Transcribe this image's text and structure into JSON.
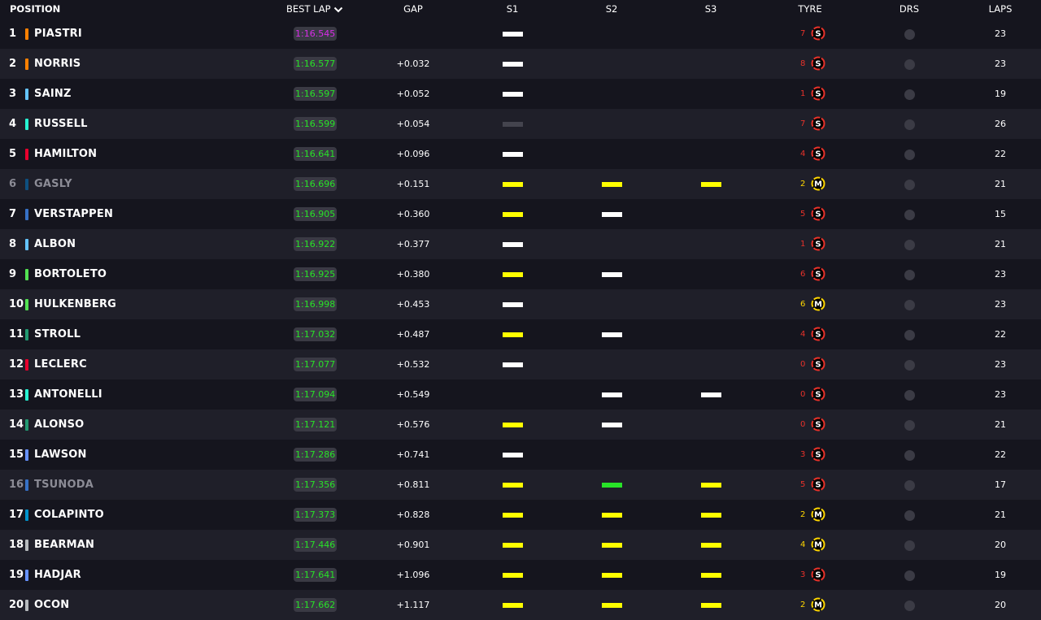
{
  "header": {
    "position": "POSITION",
    "best_lap": "BEST LAP",
    "gap": "GAP",
    "s1": "S1",
    "s2": "S2",
    "s3": "S3",
    "tyre": "TYRE",
    "drs": "DRS",
    "laps": "LAPS"
  },
  "colors": {
    "purple": "#d82ce8",
    "green": "#28e228",
    "white": "#ffffff",
    "yellow": "#ffff00",
    "soft_tyre": "#e8322a",
    "medium_tyre": "#ffd600"
  },
  "drivers": [
    {
      "pos": "1",
      "name": "PIASTRI",
      "team_color": "#ff8000",
      "best": "1:16.545",
      "best_color": "#d82ce8",
      "gap": "",
      "s1": "white",
      "s2": "",
      "s3": "",
      "tyre_age": "7",
      "tyre": "S",
      "drs": "dot",
      "laps": "23",
      "out": false
    },
    {
      "pos": "2",
      "name": "NORRIS",
      "team_color": "#ff8000",
      "best": "1:16.577",
      "best_color": "#28e228",
      "gap": "+0.032",
      "s1": "white",
      "s2": "",
      "s3": "",
      "tyre_age": "8",
      "tyre": "S",
      "drs": "dot",
      "laps": "23",
      "out": false
    },
    {
      "pos": "3",
      "name": "SAINZ",
      "team_color": "#64c4ff",
      "best": "1:16.597",
      "best_color": "#28e228",
      "gap": "+0.052",
      "s1": "white",
      "s2": "",
      "s3": "",
      "tyre_age": "1",
      "tyre": "S",
      "drs": "dot",
      "laps": "19",
      "out": false
    },
    {
      "pos": "4",
      "name": "RUSSELL",
      "team_color": "#27f4d2",
      "best": "1:16.599",
      "best_color": "#28e228",
      "gap": "+0.054",
      "s1": "grey",
      "s2": "",
      "s3": "",
      "tyre_age": "7",
      "tyre": "S",
      "drs": "dot",
      "laps": "26",
      "out": false
    },
    {
      "pos": "5",
      "name": "HAMILTON",
      "team_color": "#e8002d",
      "best": "1:16.641",
      "best_color": "#28e228",
      "gap": "+0.096",
      "s1": "white",
      "s2": "",
      "s3": "",
      "tyre_age": "4",
      "tyre": "S",
      "drs": "dot",
      "laps": "22",
      "out": false
    },
    {
      "pos": "6",
      "name": "GASLY",
      "team_color": "#0e5080",
      "best": "1:16.696",
      "best_color": "#28e228",
      "gap": "+0.151",
      "s1": "yellow",
      "s2": "yellow",
      "s3": "yellow",
      "tyre_age": "2",
      "tyre": "M",
      "drs": "dot",
      "laps": "21",
      "out": true
    },
    {
      "pos": "7",
      "name": "VERSTAPPEN",
      "team_color": "#3671c6",
      "best": "1:16.905",
      "best_color": "#28e228",
      "gap": "+0.360",
      "s1": "yellow",
      "s2": "white",
      "s3": "",
      "tyre_age": "5",
      "tyre": "S",
      "drs": "dot",
      "laps": "15",
      "out": false
    },
    {
      "pos": "8",
      "name": "ALBON",
      "team_color": "#64c4ff",
      "best": "1:16.922",
      "best_color": "#28e228",
      "gap": "+0.377",
      "s1": "white",
      "s2": "",
      "s3": "",
      "tyre_age": "1",
      "tyre": "S",
      "drs": "dot",
      "laps": "21",
      "out": false
    },
    {
      "pos": "9",
      "name": "BORTOLETO",
      "team_color": "#52e252",
      "best": "1:16.925",
      "best_color": "#28e228",
      "gap": "+0.380",
      "s1": "yellow",
      "s2": "white",
      "s3": "",
      "tyre_age": "6",
      "tyre": "S",
      "drs": "dot",
      "laps": "23",
      "out": false
    },
    {
      "pos": "10",
      "name": "HULKENBERG",
      "team_color": "#52e252",
      "best": "1:16.998",
      "best_color": "#28e228",
      "gap": "+0.453",
      "s1": "white",
      "s2": "",
      "s3": "",
      "tyre_age": "6",
      "tyre": "M",
      "drs": "dot",
      "laps": "23",
      "out": false
    },
    {
      "pos": "11",
      "name": "STROLL",
      "team_color": "#229971",
      "best": "1:17.032",
      "best_color": "#28e228",
      "gap": "+0.487",
      "s1": "yellow",
      "s2": "white",
      "s3": "",
      "tyre_age": "4",
      "tyre": "S",
      "drs": "dot",
      "laps": "22",
      "out": false
    },
    {
      "pos": "12",
      "name": "LECLERC",
      "team_color": "#e8002d",
      "best": "1:17.077",
      "best_color": "#28e228",
      "gap": "+0.532",
      "s1": "white",
      "s2": "",
      "s3": "",
      "tyre_age": "0",
      "tyre": "S",
      "drs": "dot",
      "laps": "23",
      "out": false
    },
    {
      "pos": "13",
      "name": "ANTONELLI",
      "team_color": "#27f4d2",
      "best": "1:17.094",
      "best_color": "#28e228",
      "gap": "+0.549",
      "s1": "",
      "s2": "white",
      "s3": "white",
      "tyre_age": "0",
      "tyre": "S",
      "drs": "dot",
      "laps": "23",
      "out": false
    },
    {
      "pos": "14",
      "name": "ALONSO",
      "team_color": "#229971",
      "best": "1:17.121",
      "best_color": "#28e228",
      "gap": "+0.576",
      "s1": "yellow",
      "s2": "white",
      "s3": "",
      "tyre_age": "0",
      "tyre": "S",
      "drs": "dot",
      "laps": "21",
      "out": false
    },
    {
      "pos": "15",
      "name": "LAWSON",
      "team_color": "#6692ff",
      "best": "1:17.286",
      "best_color": "#28e228",
      "gap": "+0.741",
      "s1": "white",
      "s2": "",
      "s3": "",
      "tyre_age": "3",
      "tyre": "S",
      "drs": "dot",
      "laps": "22",
      "out": false
    },
    {
      "pos": "16",
      "name": "TSUNODA",
      "team_color": "#3671c6",
      "best": "1:17.356",
      "best_color": "#28e228",
      "gap": "+0.811",
      "s1": "yellow",
      "s2": "green",
      "s3": "yellow",
      "tyre_age": "5",
      "tyre": "S",
      "drs": "dot",
      "laps": "17",
      "out": true
    },
    {
      "pos": "17",
      "name": "COLAPINTO",
      "team_color": "#0093cc",
      "best": "1:17.373",
      "best_color": "#28e228",
      "gap": "+0.828",
      "s1": "yellow",
      "s2": "yellow",
      "s3": "yellow",
      "tyre_age": "2",
      "tyre": "M",
      "drs": "dot",
      "laps": "21",
      "out": false
    },
    {
      "pos": "18",
      "name": "BEARMAN",
      "team_color": "#b6babd",
      "best": "1:17.446",
      "best_color": "#28e228",
      "gap": "+0.901",
      "s1": "yellow",
      "s2": "yellow",
      "s3": "yellow",
      "tyre_age": "4",
      "tyre": "M",
      "drs": "dot",
      "laps": "20",
      "out": false
    },
    {
      "pos": "19",
      "name": "HADJAR",
      "team_color": "#6692ff",
      "best": "1:17.641",
      "best_color": "#28e228",
      "gap": "+1.096",
      "s1": "yellow",
      "s2": "yellow",
      "s3": "yellow",
      "tyre_age": "3",
      "tyre": "S",
      "drs": "dot",
      "laps": "19",
      "out": false
    },
    {
      "pos": "20",
      "name": "OCON",
      "team_color": "#b6babd",
      "best": "1:17.662",
      "best_color": "#28e228",
      "gap": "+1.117",
      "s1": "yellow",
      "s2": "yellow",
      "s3": "yellow",
      "tyre_age": "2",
      "tyre": "M",
      "drs": "dot",
      "laps": "20",
      "out": false
    }
  ]
}
